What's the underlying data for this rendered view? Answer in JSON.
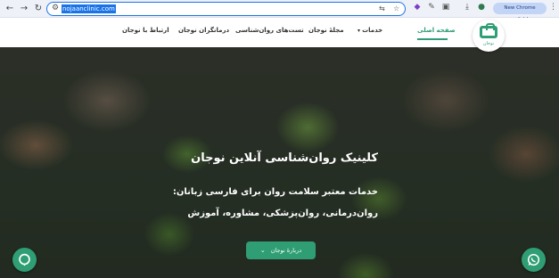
{
  "browser": {
    "url": "nojaanclinic.com",
    "update_label": "New Chrome available",
    "icons": [
      "back-arrow-icon",
      "forward-arrow-icon",
      "reload-icon",
      "site-info-icon",
      "translate-icon",
      "bookmark-star-icon",
      "extension-icon",
      "pen-icon",
      "puzzle-icon",
      "download-icon",
      "profile-icon",
      "kebab-menu-icon"
    ]
  },
  "site": {
    "logo_text": "نوجان",
    "nav": {
      "home": "صفحه اصلی",
      "services": "خدمات",
      "magazine": "مجلهٔ نوجان",
      "tests": "تست‌های روان‌شناسی",
      "therapists": "درمانگران نوجان",
      "contact": "ارتباط با نوجان"
    },
    "accent_color": "#2f9e74"
  },
  "hero": {
    "title": "کلینیک روان‌شناسی آنلاین نوجان",
    "subtitle_1": "خدمات معتبر سلامت روان برای فارسی زبانان:",
    "subtitle_2": "روان‌درمانی، روان‌پزشکی، مشاوره، آموزش",
    "about_button": "دربارهٔ نوجان"
  }
}
